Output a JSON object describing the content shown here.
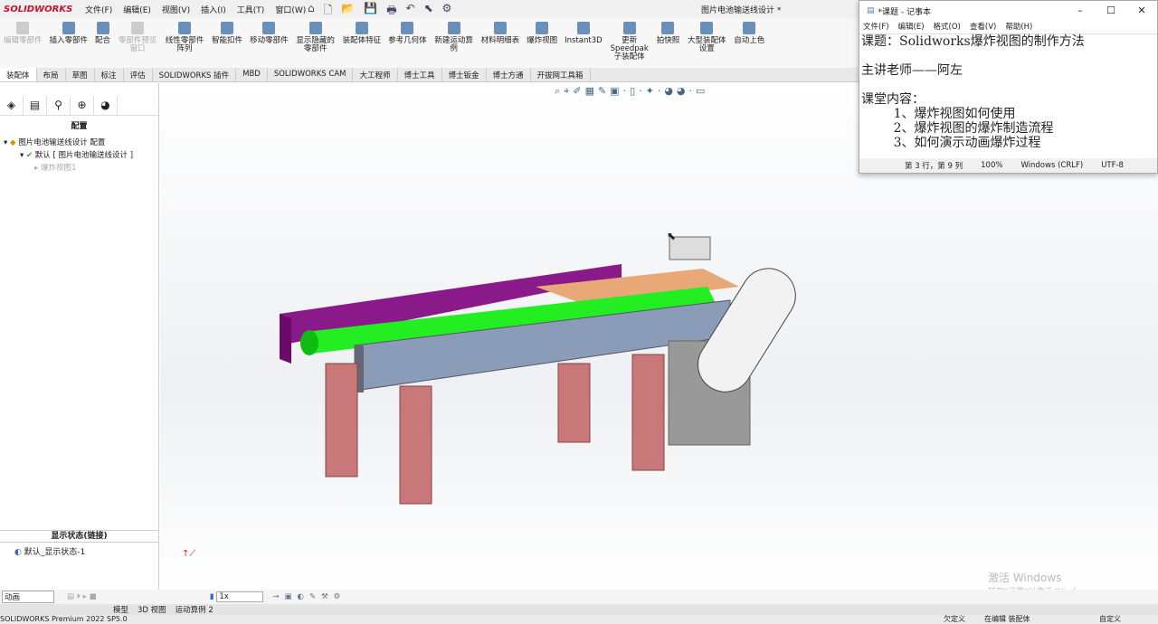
{
  "app": {
    "logo": "SOLIDWORKS",
    "doc_title": "图片电池输送线设计 *"
  },
  "menu": [
    "文件(F)",
    "编辑(E)",
    "视图(V)",
    "插入(I)",
    "工具(T)",
    "窗口(W)"
  ],
  "ribbon": [
    {
      "label": "编辑零部件",
      "disabled": true
    },
    {
      "label": "插入零部件"
    },
    {
      "label": "配合"
    },
    {
      "label": "零部件预览窗口",
      "disabled": true
    },
    {
      "label": "线性零部件阵列"
    },
    {
      "label": "智能扣件"
    },
    {
      "label": "移动零部件"
    },
    {
      "label": "显示隐藏的零部件"
    },
    {
      "label": "装配体特征"
    },
    {
      "label": "参考几何体"
    },
    {
      "label": "新建运动算例"
    },
    {
      "label": "材料明细表"
    },
    {
      "label": "爆炸视图"
    },
    {
      "label": "Instant3D"
    },
    {
      "label": "更新Speedpak子装配体"
    },
    {
      "label": "拍快照"
    },
    {
      "label": "大型装配体设置"
    },
    {
      "label": "自动上色"
    }
  ],
  "tabs": [
    "装配体",
    "布局",
    "草图",
    "标注",
    "评估",
    "SOLIDWORKS 插件",
    "MBD",
    "SOLIDWORKS CAM",
    "大工程师",
    "博士工具",
    "博士钣金",
    "博士方通",
    "开拔网工具箱"
  ],
  "panel": {
    "title": "配置",
    "tree": [
      "图片电池输送线设计 配置",
      "默认 [ 图片电池输送线设计 ]",
      "爆炸视图1"
    ],
    "display_state_title": "显示状态(链接)",
    "display_state": "默认_显示状态-1"
  },
  "notepad": {
    "title": "*课题 - 记事本",
    "menu": [
      "文件(F)",
      "编辑(E)",
      "格式(O)",
      "查看(V)",
      "帮助(H)"
    ],
    "lines": [
      "课题：Solidworks爆炸视图的制作方法",
      "",
      "主讲老师——阿左",
      "",
      "课堂内容：",
      "        1、爆炸视图如何使用",
      "        2、爆炸视图的爆炸制造流程",
      "        3、如何演示动画爆炸过程"
    ],
    "status": {
      "pos": "第 3 行，第 9 列",
      "zoom": "100%",
      "eol": "Windows (CRLF)",
      "enc": "UTF-8"
    }
  },
  "motion": {
    "type": "动画",
    "speed": "1x"
  },
  "bottom_tabs": [
    "模型",
    "3D 视图",
    "运动算例 2"
  ],
  "status": {
    "product": "SOLIDWORKS Premium 2022 SP5.0",
    "state": "欠定义",
    "editing": "在编辑 装配体",
    "custom": "自定义"
  },
  "watermark": {
    "line1": "激活 Windows",
    "line2": "转到\"设置\"以激活 Windows。"
  }
}
